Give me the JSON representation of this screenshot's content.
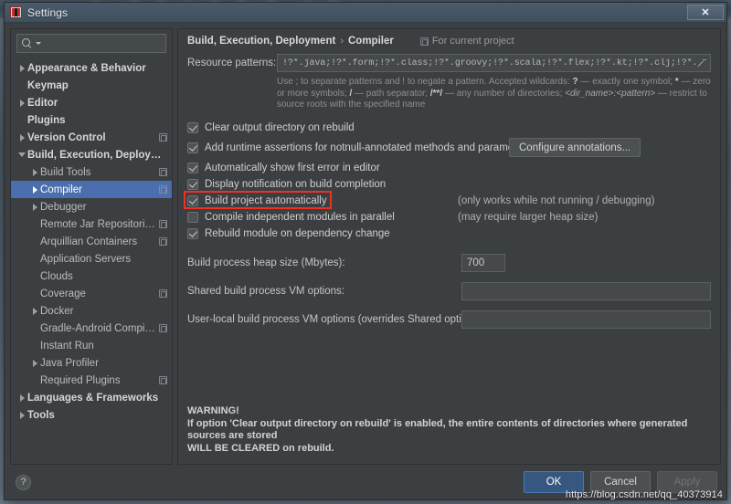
{
  "window": {
    "title": "Settings",
    "close_label": "✕",
    "app_icon": "intellij-idea-icon"
  },
  "sidebar": {
    "search": {
      "placeholder": "",
      "value": "",
      "icon": "search-icon"
    },
    "items": [
      {
        "label": "Appearance & Behavior",
        "indent": 1,
        "arrow": "closed",
        "bold": true,
        "badge": false,
        "selected": false
      },
      {
        "label": "Keymap",
        "indent": 1,
        "arrow": "none",
        "bold": true,
        "badge": false,
        "selected": false
      },
      {
        "label": "Editor",
        "indent": 1,
        "arrow": "closed",
        "bold": true,
        "badge": false,
        "selected": false
      },
      {
        "label": "Plugins",
        "indent": 1,
        "arrow": "none",
        "bold": true,
        "badge": false,
        "selected": false
      },
      {
        "label": "Version Control",
        "indent": 1,
        "arrow": "closed",
        "bold": true,
        "badge": true,
        "selected": false
      },
      {
        "label": "Build, Execution, Deployment",
        "indent": 1,
        "arrow": "open",
        "bold": true,
        "badge": false,
        "selected": false
      },
      {
        "label": "Build Tools",
        "indent": 2,
        "arrow": "closed",
        "bold": false,
        "badge": true,
        "selected": false
      },
      {
        "label": "Compiler",
        "indent": 2,
        "arrow": "closed",
        "bold": false,
        "badge": true,
        "selected": true
      },
      {
        "label": "Debugger",
        "indent": 2,
        "arrow": "closed",
        "bold": false,
        "badge": false,
        "selected": false
      },
      {
        "label": "Remote Jar Repositories",
        "indent": 2,
        "arrow": "none",
        "bold": false,
        "badge": true,
        "selected": false
      },
      {
        "label": "Arquillian Containers",
        "indent": 2,
        "arrow": "none",
        "bold": false,
        "badge": true,
        "selected": false
      },
      {
        "label": "Application Servers",
        "indent": 2,
        "arrow": "none",
        "bold": false,
        "badge": false,
        "selected": false
      },
      {
        "label": "Clouds",
        "indent": 2,
        "arrow": "none",
        "bold": false,
        "badge": false,
        "selected": false
      },
      {
        "label": "Coverage",
        "indent": 2,
        "arrow": "none",
        "bold": false,
        "badge": true,
        "selected": false
      },
      {
        "label": "Docker",
        "indent": 2,
        "arrow": "closed",
        "bold": false,
        "badge": false,
        "selected": false
      },
      {
        "label": "Gradle-Android Compiler",
        "indent": 2,
        "arrow": "none",
        "bold": false,
        "badge": true,
        "selected": false
      },
      {
        "label": "Instant Run",
        "indent": 2,
        "arrow": "none",
        "bold": false,
        "badge": false,
        "selected": false
      },
      {
        "label": "Java Profiler",
        "indent": 2,
        "arrow": "closed",
        "bold": false,
        "badge": false,
        "selected": false
      },
      {
        "label": "Required Plugins",
        "indent": 2,
        "arrow": "none",
        "bold": false,
        "badge": true,
        "selected": false
      },
      {
        "label": "Languages & Frameworks",
        "indent": 1,
        "arrow": "closed",
        "bold": true,
        "badge": false,
        "selected": false
      },
      {
        "label": "Tools",
        "indent": 1,
        "arrow": "closed",
        "bold": true,
        "badge": false,
        "selected": false
      }
    ]
  },
  "main": {
    "breadcrumb": {
      "root": "Build, Execution, Deployment",
      "separator": "›",
      "leaf": "Compiler"
    },
    "scope": {
      "label": "For current project",
      "icon": "project-scope-icon"
    },
    "resource_patterns": {
      "label": "Resource patterns:",
      "value": "!?*.java;!?*.form;!?*.class;!?*.groovy;!?*.scala;!?*.flex;!?*.kt;!?*.clj;!?*.aj",
      "expand_icon": "expand-arrow-icon"
    },
    "hint": {
      "part1": "Use ; to separate patterns and ! to negate a pattern. Accepted wildcards: ",
      "b1": "?",
      "part2": " — exactly one symbol; ",
      "b2": "*",
      "part3": " — zero or more symbols; ",
      "b3": "/",
      "part4": " — path separator; ",
      "b4": "/**/",
      "part5": " — any number of directories; ",
      "i1": "<dir_name>:<pattern>",
      "part6": " — restrict to source roots with the specified name"
    },
    "checkboxes": [
      {
        "label": "Clear output directory on rebuild",
        "checked": true,
        "note": "",
        "button": ""
      },
      {
        "label": "Add runtime assertions for notnull-annotated methods and parameters",
        "checked": true,
        "note": "",
        "button": "Configure annotations..."
      },
      {
        "label": "Automatically show first error in editor",
        "checked": true,
        "note": "",
        "button": ""
      },
      {
        "label": "Display notification on build completion",
        "checked": true,
        "note": "",
        "button": ""
      },
      {
        "label": "Build project automatically",
        "checked": true,
        "note": "(only works while not running / debugging)",
        "button": "",
        "highlight": true
      },
      {
        "label": "Compile independent modules in parallel",
        "checked": false,
        "note": "(may require larger heap size)",
        "button": ""
      },
      {
        "label": "Rebuild module on dependency change",
        "checked": true,
        "note": "",
        "button": ""
      }
    ],
    "fields": [
      {
        "label": "Build process heap size (Mbytes):",
        "value": "700",
        "kind": "heap"
      },
      {
        "label": "Shared build process VM options:",
        "value": "",
        "kind": "wide"
      },
      {
        "label": "User-local build process VM options (overrides Shared options):",
        "value": "",
        "kind": "wide2"
      }
    ],
    "warning": {
      "line1": "WARNING!",
      "line2": "If option 'Clear output directory on rebuild' is enabled, the entire contents of directories where generated sources are stored",
      "line3": "WILL BE CLEARED on rebuild."
    }
  },
  "footer": {
    "help_label": "?",
    "ok_label": "OK",
    "cancel_label": "Cancel",
    "apply_label": "Apply"
  },
  "watermark": "https://blog.csdn.net/qq_40373914",
  "colors": {
    "accent_selection": "#4b6eaf",
    "primary_button": "#365880",
    "highlight_box": "#ef3124",
    "panel_bg": "#3c3f41",
    "field_bg": "#45494a"
  }
}
